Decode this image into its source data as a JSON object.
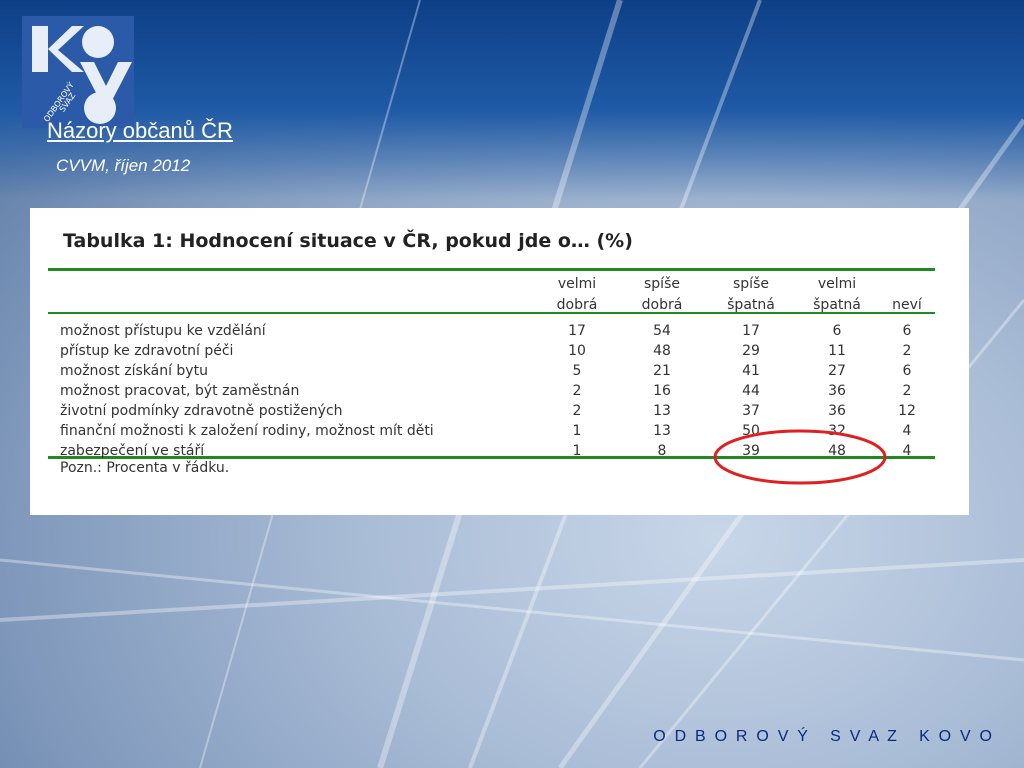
{
  "header": {
    "title": "Názory občanů ČR",
    "subtitle": "CVVM, říjen 2012",
    "logo": {
      "letters": "KOV",
      "text": "ODBOROVÝ SVAZ",
      "colors": {
        "bg": "#2a5aa8",
        "shape": "#e8eef8"
      }
    }
  },
  "table": {
    "caption": "Tabulka 1: Hodnocení situace v ČR, pokud jde o… (%)",
    "columns": [
      [
        "velmi",
        "dobrá"
      ],
      [
        "spíše",
        "dobrá"
      ],
      [
        "spíše",
        "špatná"
      ],
      [
        "velmi",
        "špatná"
      ],
      [
        "neví",
        ""
      ]
    ],
    "rows": [
      {
        "label": "možnost přístupu ke vzdělání",
        "values": [
          "17",
          "54",
          "17",
          "6",
          "6"
        ]
      },
      {
        "label": "přístup ke zdravotní péči",
        "values": [
          "10",
          "48",
          "29",
          "11",
          "2"
        ]
      },
      {
        "label": "možnost získání bytu",
        "values": [
          "5",
          "21",
          "41",
          "27",
          "6"
        ]
      },
      {
        "label": "možnost pracovat, být zaměstnán",
        "values": [
          "2",
          "16",
          "44",
          "36",
          "2"
        ]
      },
      {
        "label": "životní podmínky zdravotně postižených",
        "values": [
          "2",
          "13",
          "37",
          "36",
          "12"
        ]
      },
      {
        "label": "finanční možnosti k založení rodiny, možnost mít děti",
        "values": [
          "1",
          "13",
          "50",
          "32",
          "4"
        ]
      },
      {
        "label": "zabezpečení ve stáří",
        "values": [
          "1",
          "8",
          "39",
          "48",
          "4"
        ]
      }
    ],
    "note": "Pozn.: Procenta v řádku.",
    "rule_color": "#1f8a1f",
    "highlight_color": "#e02020"
  },
  "footer": {
    "text": "O  D  B  O  R  O  V  Ý     S  V  A  Z     K  O  V  O"
  }
}
